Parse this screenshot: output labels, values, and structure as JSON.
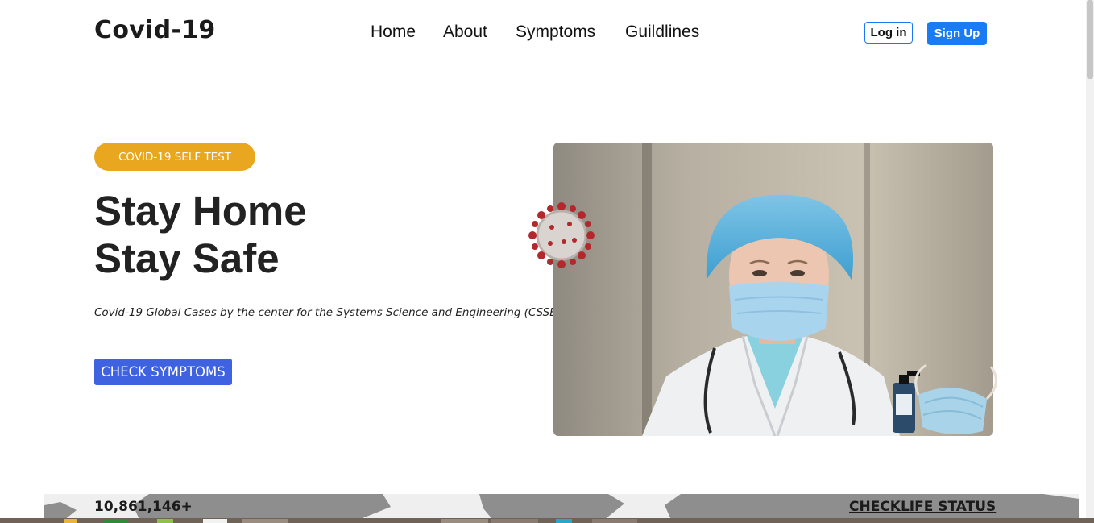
{
  "header": {
    "brand": "Covid-19",
    "nav": [
      {
        "label": "Home"
      },
      {
        "label": "About"
      },
      {
        "label": "Symptoms"
      },
      {
        "label": "Guildlines"
      }
    ],
    "login_label": "Log in",
    "signup_label": "Sign Up"
  },
  "hero": {
    "badge": "COVID-19 SELF TEST",
    "title_line1": "Stay Home",
    "title_line2": "Stay Safe",
    "subtitle": "Covid-19 Global Cases by the center for the Systems Science and Engineering (CSSE)",
    "cta_label": "CHECK SYMPTOMS"
  },
  "stats": {
    "cases": "10,861,146+",
    "checklife": "CHECKLIFE STATUS"
  },
  "colors": {
    "brand_text": "#1b1b1b",
    "badge": "#e8a71e",
    "cta": "#3f63e0",
    "signup": "#1a7cf5",
    "login_border": "#1877f2"
  }
}
